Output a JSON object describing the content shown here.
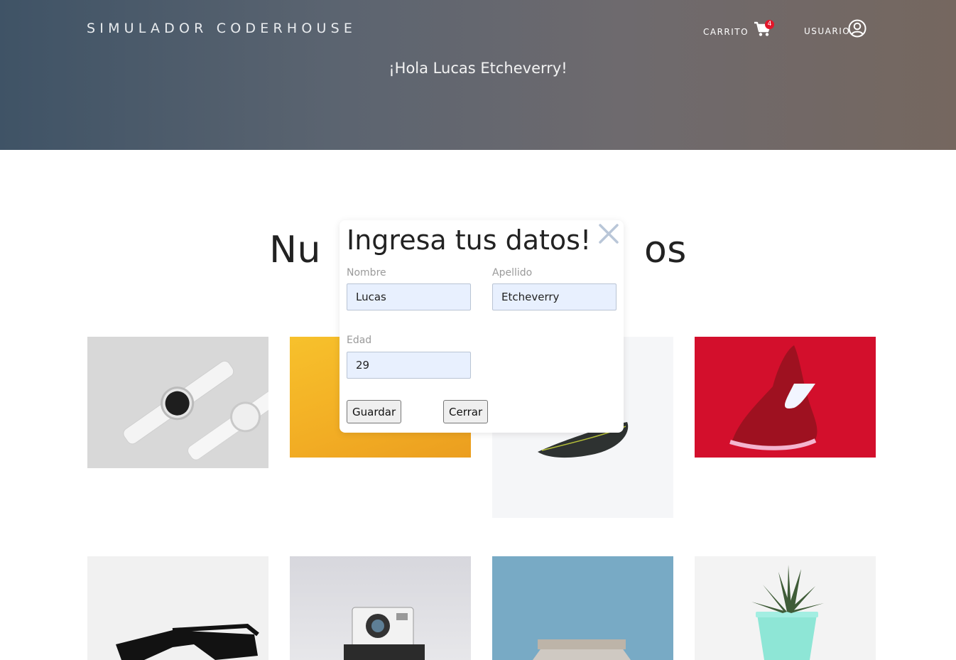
{
  "header": {
    "brand": "SIMULADOR CODERHOUSE",
    "cart_label": "CARRITO",
    "cart_count": "4",
    "user_label": "USUARIO",
    "greeting": "¡Hola Lucas Etcheverry!"
  },
  "section": {
    "title_left": "Nu",
    "title_right": "os"
  },
  "modal": {
    "title": "Ingresa tus datos!",
    "close_icon": "close-icon",
    "fields": {
      "nombre": {
        "label": "Nombre",
        "value": "Lucas"
      },
      "apellido": {
        "label": "Apellido",
        "value": "Etcheverry"
      },
      "edad": {
        "label": "Edad",
        "value": "29"
      }
    },
    "save_label": "Guardar",
    "cancel_label": "Cerrar"
  },
  "colors": {
    "header_gradient_start": "#3f5366",
    "header_gradient_end": "#75675f",
    "badge": "#e3162a",
    "input_bg": "#e8f0fe"
  },
  "icons": {
    "cart": "shopping-cart-icon",
    "user": "user-circle-icon"
  }
}
